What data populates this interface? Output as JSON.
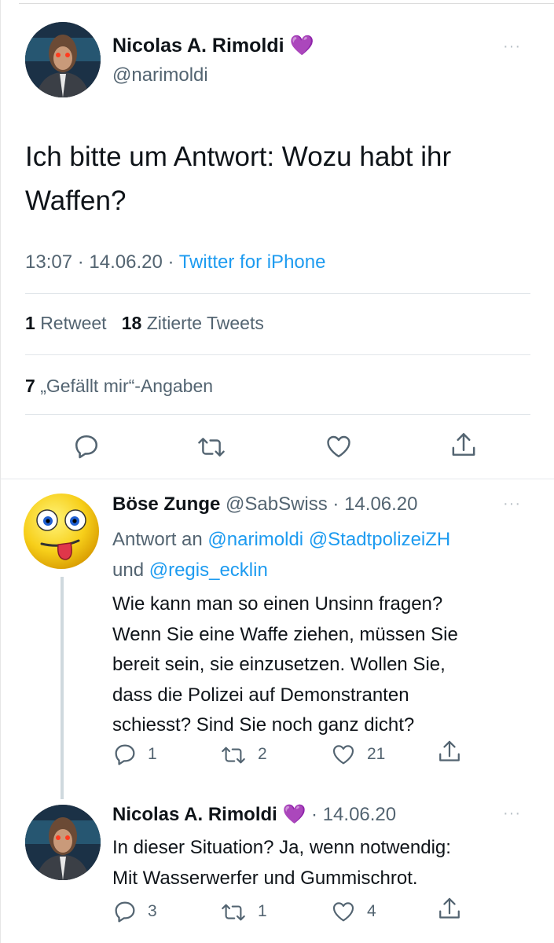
{
  "main_tweet": {
    "author_name": "Nicolas A. Rimoldi",
    "author_emoji": "💜",
    "handle": "@narimoldi",
    "text_line1": "Ich bitte um Antwort: Wozu habt ihr",
    "text_line2": "Waffen?",
    "time": "13:07 · 14.06.20 ·",
    "source": "Twitter for iPhone",
    "retweets_count": "1",
    "retweets_label": "Retweet",
    "quotes_count": "18",
    "quotes_label": "Zitierte Tweets",
    "likes_count": "7",
    "likes_label": "„Gefällt mir“-Angaben",
    "more": "···"
  },
  "reply1": {
    "author_name": "Böse Zunge",
    "handle_date": "@SabSwiss · 14.06.20",
    "replying_prefix": "Antwort an",
    "mention1": "@narimoldi",
    "mention2": "@StadtpolizeiZH",
    "and_word": "und",
    "mention3": "@regis_ecklin",
    "text_lines": [
      "Wie kann man so einen Unsinn fragen?",
      "Wenn Sie eine Waffe ziehen, müssen Sie",
      "bereit sein, sie einzusetzen. Wollen Sie,",
      "dass die Polizei auf Demonstranten",
      "schiesst? Sind Sie noch ganz dicht?"
    ],
    "reply_count": "1",
    "retweet_count": "2",
    "like_count": "21",
    "more": "···"
  },
  "reply2": {
    "author_name": "Nicolas A. Rimoldi",
    "author_emoji": "💜",
    "date": "· 14.06.20",
    "text_lines": [
      "In dieser Situation? Ja, wenn notwendig:",
      "Mit Wasserwerfer und Gummischrot."
    ],
    "reply_count": "3",
    "retweet_count": "1",
    "like_count": "4",
    "more": "···"
  },
  "colors": {
    "link": "#1d9bf0",
    "muted": "#536471",
    "separator": "#e1e6ea"
  },
  "icons": [
    "reply-icon",
    "retweet-icon",
    "like-icon",
    "share-icon",
    "more-icon"
  ]
}
